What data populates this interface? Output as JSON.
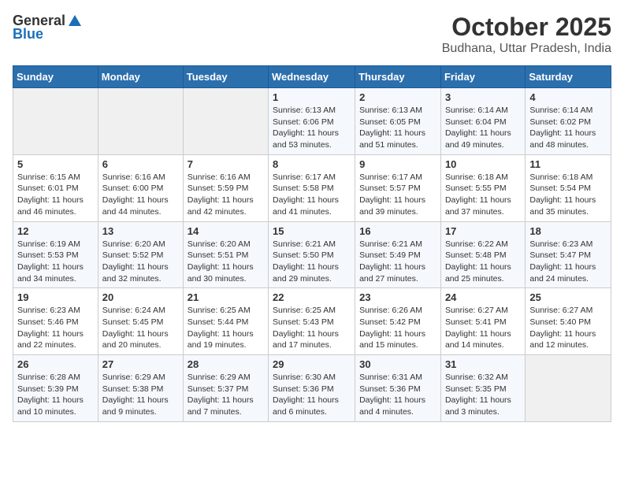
{
  "header": {
    "logo_general": "General",
    "logo_blue": "Blue",
    "month": "October 2025",
    "location": "Budhana, Uttar Pradesh, India"
  },
  "weekdays": [
    "Sunday",
    "Monday",
    "Tuesday",
    "Wednesday",
    "Thursday",
    "Friday",
    "Saturday"
  ],
  "weeks": [
    [
      {
        "day": "",
        "info": ""
      },
      {
        "day": "",
        "info": ""
      },
      {
        "day": "",
        "info": ""
      },
      {
        "day": "1",
        "info": "Sunrise: 6:13 AM\nSunset: 6:06 PM\nDaylight: 11 hours\nand 53 minutes."
      },
      {
        "day": "2",
        "info": "Sunrise: 6:13 AM\nSunset: 6:05 PM\nDaylight: 11 hours\nand 51 minutes."
      },
      {
        "day": "3",
        "info": "Sunrise: 6:14 AM\nSunset: 6:04 PM\nDaylight: 11 hours\nand 49 minutes."
      },
      {
        "day": "4",
        "info": "Sunrise: 6:14 AM\nSunset: 6:02 PM\nDaylight: 11 hours\nand 48 minutes."
      }
    ],
    [
      {
        "day": "5",
        "info": "Sunrise: 6:15 AM\nSunset: 6:01 PM\nDaylight: 11 hours\nand 46 minutes."
      },
      {
        "day": "6",
        "info": "Sunrise: 6:16 AM\nSunset: 6:00 PM\nDaylight: 11 hours\nand 44 minutes."
      },
      {
        "day": "7",
        "info": "Sunrise: 6:16 AM\nSunset: 5:59 PM\nDaylight: 11 hours\nand 42 minutes."
      },
      {
        "day": "8",
        "info": "Sunrise: 6:17 AM\nSunset: 5:58 PM\nDaylight: 11 hours\nand 41 minutes."
      },
      {
        "day": "9",
        "info": "Sunrise: 6:17 AM\nSunset: 5:57 PM\nDaylight: 11 hours\nand 39 minutes."
      },
      {
        "day": "10",
        "info": "Sunrise: 6:18 AM\nSunset: 5:55 PM\nDaylight: 11 hours\nand 37 minutes."
      },
      {
        "day": "11",
        "info": "Sunrise: 6:18 AM\nSunset: 5:54 PM\nDaylight: 11 hours\nand 35 minutes."
      }
    ],
    [
      {
        "day": "12",
        "info": "Sunrise: 6:19 AM\nSunset: 5:53 PM\nDaylight: 11 hours\nand 34 minutes."
      },
      {
        "day": "13",
        "info": "Sunrise: 6:20 AM\nSunset: 5:52 PM\nDaylight: 11 hours\nand 32 minutes."
      },
      {
        "day": "14",
        "info": "Sunrise: 6:20 AM\nSunset: 5:51 PM\nDaylight: 11 hours\nand 30 minutes."
      },
      {
        "day": "15",
        "info": "Sunrise: 6:21 AM\nSunset: 5:50 PM\nDaylight: 11 hours\nand 29 minutes."
      },
      {
        "day": "16",
        "info": "Sunrise: 6:21 AM\nSunset: 5:49 PM\nDaylight: 11 hours\nand 27 minutes."
      },
      {
        "day": "17",
        "info": "Sunrise: 6:22 AM\nSunset: 5:48 PM\nDaylight: 11 hours\nand 25 minutes."
      },
      {
        "day": "18",
        "info": "Sunrise: 6:23 AM\nSunset: 5:47 PM\nDaylight: 11 hours\nand 24 minutes."
      }
    ],
    [
      {
        "day": "19",
        "info": "Sunrise: 6:23 AM\nSunset: 5:46 PM\nDaylight: 11 hours\nand 22 minutes."
      },
      {
        "day": "20",
        "info": "Sunrise: 6:24 AM\nSunset: 5:45 PM\nDaylight: 11 hours\nand 20 minutes."
      },
      {
        "day": "21",
        "info": "Sunrise: 6:25 AM\nSunset: 5:44 PM\nDaylight: 11 hours\nand 19 minutes."
      },
      {
        "day": "22",
        "info": "Sunrise: 6:25 AM\nSunset: 5:43 PM\nDaylight: 11 hours\nand 17 minutes."
      },
      {
        "day": "23",
        "info": "Sunrise: 6:26 AM\nSunset: 5:42 PM\nDaylight: 11 hours\nand 15 minutes."
      },
      {
        "day": "24",
        "info": "Sunrise: 6:27 AM\nSunset: 5:41 PM\nDaylight: 11 hours\nand 14 minutes."
      },
      {
        "day": "25",
        "info": "Sunrise: 6:27 AM\nSunset: 5:40 PM\nDaylight: 11 hours\nand 12 minutes."
      }
    ],
    [
      {
        "day": "26",
        "info": "Sunrise: 6:28 AM\nSunset: 5:39 PM\nDaylight: 11 hours\nand 10 minutes."
      },
      {
        "day": "27",
        "info": "Sunrise: 6:29 AM\nSunset: 5:38 PM\nDaylight: 11 hours\nand 9 minutes."
      },
      {
        "day": "28",
        "info": "Sunrise: 6:29 AM\nSunset: 5:37 PM\nDaylight: 11 hours\nand 7 minutes."
      },
      {
        "day": "29",
        "info": "Sunrise: 6:30 AM\nSunset: 5:36 PM\nDaylight: 11 hours\nand 6 minutes."
      },
      {
        "day": "30",
        "info": "Sunrise: 6:31 AM\nSunset: 5:36 PM\nDaylight: 11 hours\nand 4 minutes."
      },
      {
        "day": "31",
        "info": "Sunrise: 6:32 AM\nSunset: 5:35 PM\nDaylight: 11 hours\nand 3 minutes."
      },
      {
        "day": "",
        "info": ""
      }
    ]
  ]
}
